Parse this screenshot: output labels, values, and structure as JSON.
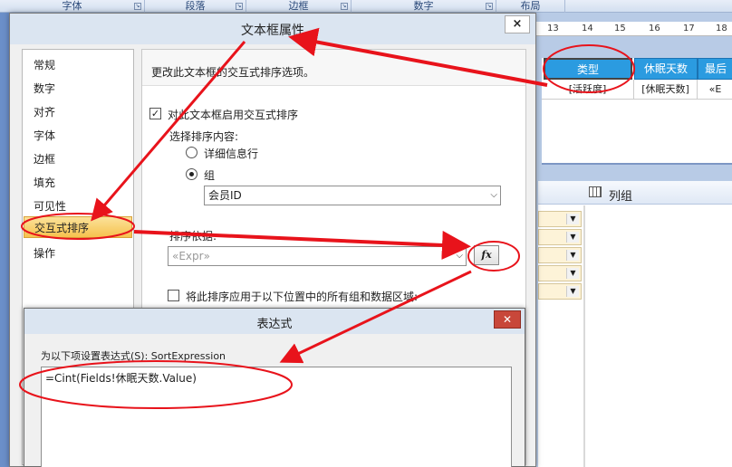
{
  "ribbon": {
    "groups": [
      "字体",
      "段落",
      "边框",
      "数字",
      "布局"
    ]
  },
  "designer": {
    "ruler_ticks": [
      "13",
      "14",
      "15",
      "16",
      "17",
      "18"
    ],
    "headers": [
      "类型",
      "休眠天数",
      "最后"
    ],
    "data": [
      "[活跃度]",
      "[休眠天数]",
      "«E"
    ],
    "groups_title": "列组"
  },
  "dialog": {
    "title": "文本框属性",
    "close": "×",
    "nav": [
      "常规",
      "数字",
      "对齐",
      "字体",
      "边框",
      "填充",
      "可见性",
      "交互式排序",
      "操作"
    ],
    "selected_nav": "交互式排序",
    "description": "更改此文本框的交互式排序选项。",
    "enable_sort_label": "对此文本框启用交互式排序",
    "enable_sort_checked": true,
    "choose_content_label": "选择排序内容:",
    "radio_detail": "详细信息行",
    "radio_group": "组",
    "group_value": "会员ID",
    "sort_by_label": "排序依据:",
    "sort_by_placeholder": "«Expr»",
    "fx_label": "fx",
    "apply_all_label": "将此排序应用于以下位置中的所有组和数据区域:"
  },
  "expression": {
    "title": "表达式",
    "close": "✕",
    "set_label": "为以下项设置表达式(S): SortExpression",
    "value": "=Cint(Fields!休眠天数.Value)"
  },
  "colors": {
    "annotation": "#e8131b",
    "accent_header": "#2b9be0",
    "selected_nav": "#f6c24e"
  }
}
